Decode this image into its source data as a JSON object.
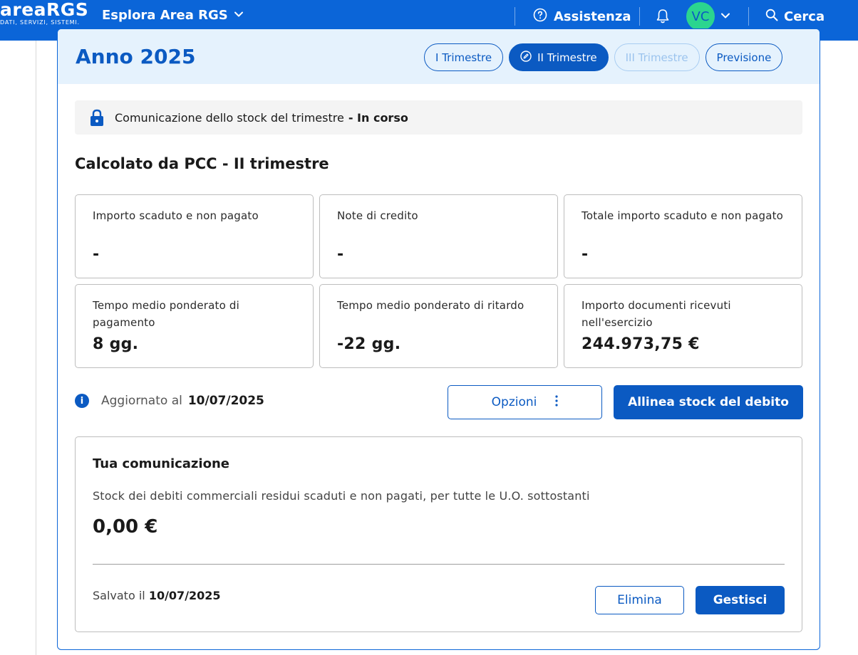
{
  "header": {
    "logo_text": "areaRGS",
    "logo_tagline": "DATI, SERVIZI, SISTEMI.",
    "explore_label": "Esplora Area RGS",
    "assistance_label": "Assistenza",
    "avatar_initials": "VC",
    "search_label": "Cerca",
    "icons": [
      "chevron-down-icon",
      "help-circle-icon",
      "bell-icon",
      "chevron-down-icon",
      "search-icon"
    ]
  },
  "year_panel": {
    "title": "Anno 2025",
    "tabs": [
      {
        "label": "I Trimestre",
        "state": "default"
      },
      {
        "label": "II Trimestre",
        "state": "active"
      },
      {
        "label": "III Trimestre",
        "state": "disabled"
      },
      {
        "label": "Previsione",
        "state": "default"
      }
    ]
  },
  "notice": {
    "text": "Comunicazione dello stock del trimestre",
    "status": "- In corso",
    "icon": "lock-icon"
  },
  "calc": {
    "title": "Calcolato da PCC - II trimestre",
    "cards": [
      {
        "label": "Importo scaduto e non pagato",
        "value": "-"
      },
      {
        "label": "Note di credito",
        "value": "-"
      },
      {
        "label": "Totale importo scaduto e non pagato",
        "value": "-"
      },
      {
        "label": "Tempo medio ponderato di pagamento",
        "value": "8 gg."
      },
      {
        "label": "Tempo medio ponderato di ritardo",
        "value": "-22 gg."
      },
      {
        "label": "Importo documenti ricevuti nell'esercizio",
        "value": "244.973,75 €"
      }
    ]
  },
  "actions": {
    "updated_label": "Aggiornato al",
    "updated_date": "10/07/2025",
    "options_label": "Opzioni",
    "align_label": "Allinea stock del debito"
  },
  "communication": {
    "title": "Tua comunicazione",
    "description": "Stock dei debiti commerciali residui scaduti e non pagati, per tutte le U.O. sottostanti",
    "amount": "0,00 €",
    "saved_label": "Salvato il",
    "saved_date": "10/07/2025",
    "delete_label": "Elimina",
    "manage_label": "Gestisci"
  },
  "colors": {
    "primary": "#0b5ac2",
    "header_bg": "#0b65d8",
    "avatar_bg": "#2bd58f",
    "panel_head_bg": "#e5f2fd"
  }
}
